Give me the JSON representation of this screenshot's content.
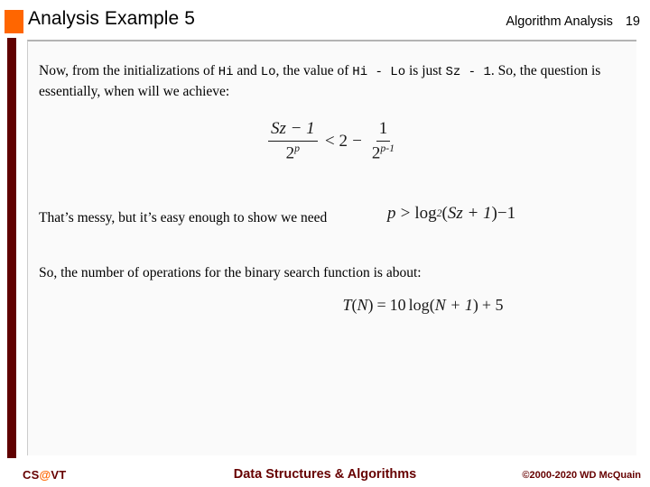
{
  "header": {
    "title": "Analysis Example 5",
    "subject": "Algorithm Analysis",
    "slide_number": "19",
    "accent_color": "#ff6600"
  },
  "sidebar": {
    "bar_color": "#600000"
  },
  "content": {
    "paragraph_intro": {
      "seg1": "Now, from the initializations of ",
      "code1": "Hi",
      "seg2": " and ",
      "code2": "Lo",
      "seg3": ", the value of ",
      "code3": "Hi - Lo",
      "seg4": " is just ",
      "code4": "Sz - 1",
      "seg5": ". So, the question is essentially, when will we achieve:"
    },
    "equation_inequality": {
      "numerator_left": "Sz − 1",
      "denominator_left": "2",
      "denominator_left_exp": "p",
      "relation": "<",
      "right_whole": "2",
      "right_minus": "−",
      "numerator_right": "1",
      "denominator_right": "2",
      "denominator_right_exp": "p-1",
      "plain": "(Sz − 1) / 2^p  <  2 − 1 / 2^(p−1)"
    },
    "paragraph_messy": "That’s messy, but it’s easy enough to show we need",
    "equation_log": {
      "var": "p",
      "relation": ">",
      "fn": "log",
      "base": "2",
      "arg_open": "(",
      "arg": "Sz + 1",
      "arg_close": ")",
      "tail": "−1",
      "plain": "p > log₂(Sz + 1) − 1"
    },
    "paragraph_ops": "So, the number of operations for the binary search function is about:",
    "equation_tn": {
      "lhs_fn": "T",
      "lhs_open": "(",
      "lhs_arg": "N",
      "lhs_close": ")",
      "equals": "=",
      "coefficient": "10",
      "fn": "log",
      "arg_open": "(",
      "arg": "N + 1",
      "arg_close": ")",
      "tail": "+ 5",
      "plain": "T(N) = 10 log(N + 1) + 5"
    }
  },
  "footer": {
    "logo_prefix": "CS",
    "logo_at": "@",
    "logo_suffix": "VT",
    "course": "Data Structures & Algorithms",
    "copyright": "©2000-2020 WD McQuain",
    "text_color": "#660000"
  }
}
